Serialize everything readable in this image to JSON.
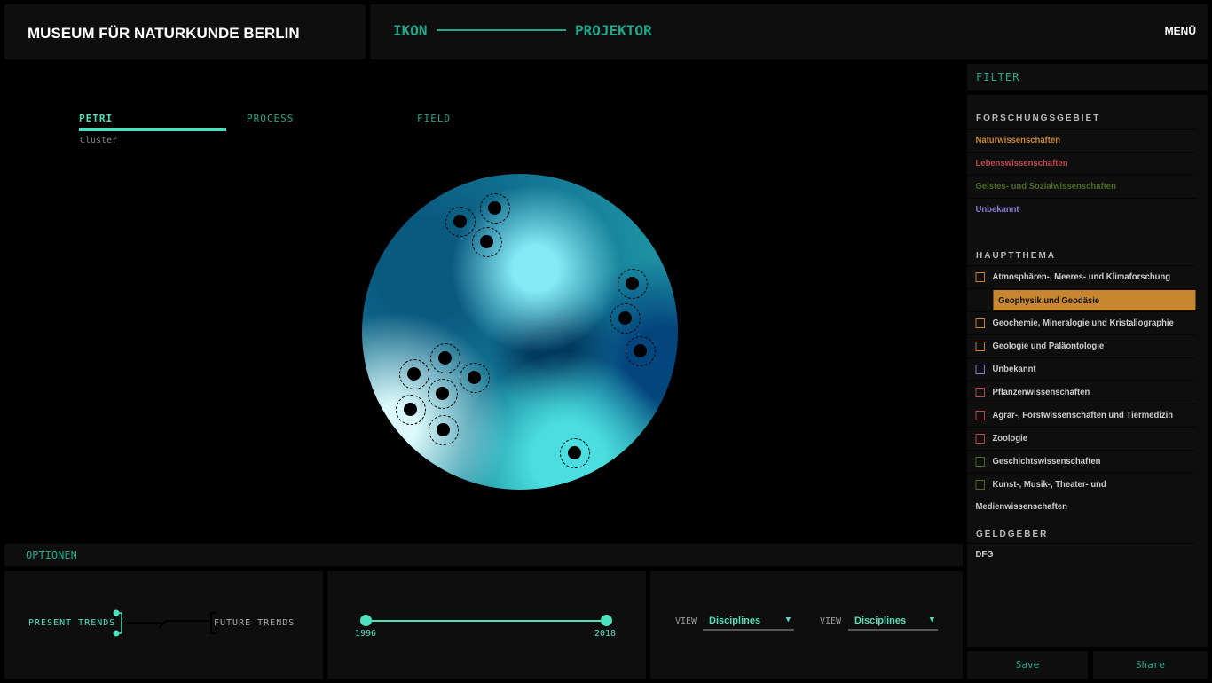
{
  "brand": "MUSEUM FÜR NATURKUNDE BERLIN",
  "nav": {
    "left": "IKON",
    "right": "PROJEKTOR",
    "menu": "MENÜ"
  },
  "tabs": [
    {
      "label": "PETRI"
    },
    {
      "label": "PROCESS"
    },
    {
      "label": "FIELD"
    }
  ],
  "subtitle": "Cluster",
  "filter": {
    "title": "FILTER",
    "forschung_title": "FORSCHUNGSGEBIET",
    "forschung": [
      {
        "label": "Naturwissenschaften",
        "color": "#c8872e"
      },
      {
        "label": "Lebenswissenschaften",
        "color": "#c04850"
      },
      {
        "label": "Geistes- und Sozialwissenschaften",
        "color": "#4a6a20"
      },
      {
        "label": "Unbekannt",
        "color": "#8a80d0"
      }
    ],
    "haupt_title": "HAUPTTHEMA",
    "haupt": [
      {
        "label": "Atmosphären-, Meeres- und Klimaforschung",
        "color": "#c8872e"
      },
      {
        "label": "Geophysik und Geodäsie",
        "color": "#c8872e",
        "selected": true
      },
      {
        "label": "Geochemie, Mineralogie und Kristallographie",
        "color": "#c8872e"
      },
      {
        "label": "Geologie und Paläontologie",
        "color": "#c8872e"
      },
      {
        "label": "Unbekannt",
        "color": "#8a80d0"
      },
      {
        "label": "Pflanzenwissenschaften",
        "color": "#c04850"
      },
      {
        "label": "Agrar-, Forstwissenschaften und Tiermedizin",
        "color": "#c04850"
      },
      {
        "label": "Zoologie",
        "color": "#c04850"
      },
      {
        "label": "Geschichtswissenschaften",
        "color": "#4a6a20"
      },
      {
        "label": "Kunst-, Musik-, Theater- und Medienwissenschaften",
        "color": "#4a6a20"
      }
    ],
    "geld_title": "GELDGEBER",
    "geld": [
      "DFG"
    ]
  },
  "options": {
    "title": "OPTIONEN",
    "present": "PRESENT TRENDS",
    "future": "FUTURE TRENDS",
    "year_start": "1996",
    "year_end": "2018",
    "view1_label": "VIEW",
    "view1_value": "Disciplines",
    "view2_label": "VIEW",
    "view2_value": "Disciplines"
  },
  "actions": {
    "save": "Save",
    "share": "Share"
  }
}
